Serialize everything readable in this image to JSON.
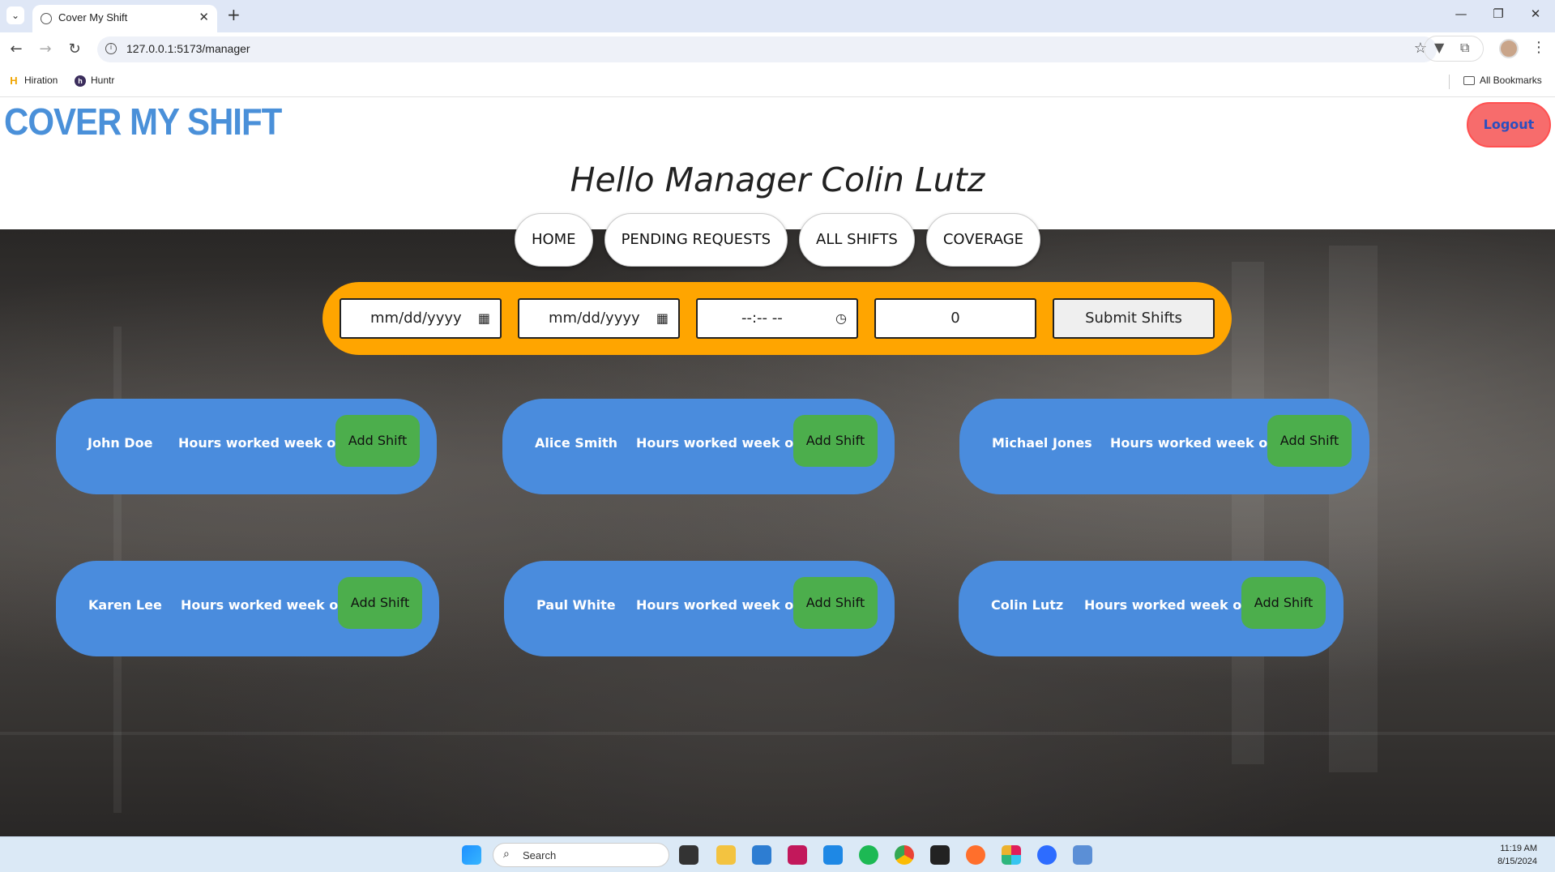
{
  "browser": {
    "tab_title": "Cover My Shift",
    "url": "127.0.0.1:5173/manager",
    "bookmarks": [
      {
        "label": "Hiration",
        "icon": "hiration-icon"
      },
      {
        "label": "Huntr",
        "icon": "huntr-icon"
      }
    ],
    "all_bookmarks": "All Bookmarks"
  },
  "header": {
    "logo": "COVER MY SHIFT",
    "logout": "Logout",
    "greeting": "Hello Manager Colin Lutz"
  },
  "nav": [
    "HOME",
    "PENDING REQUESTS",
    "ALL SHIFTS",
    "COVERAGE"
  ],
  "form": {
    "start_date_placeholder": "mm/dd/yyyy",
    "end_date_placeholder": "mm/dd/yyyy",
    "time_placeholder": "--:-- --",
    "hours_value": "0",
    "submit_label": "Submit Shifts"
  },
  "employees": [
    {
      "name": "John Doe",
      "hours_label": "Hours worked week of:",
      "add_label": "Add Shift"
    },
    {
      "name": "Alice Smith",
      "hours_label": "Hours worked week of:",
      "add_label": "Add Shift"
    },
    {
      "name": "Michael Jones",
      "hours_label": "Hours worked week of:",
      "add_label": "Add Shift"
    },
    {
      "name": "Karen Lee",
      "hours_label": "Hours worked week of:",
      "add_label": "Add Shift"
    },
    {
      "name": "Paul White",
      "hours_label": "Hours worked week of:",
      "add_label": "Add Shift"
    },
    {
      "name": "Colin Lutz",
      "hours_label": "Hours worked week of:",
      "add_label": "Add Shift"
    }
  ],
  "taskbar": {
    "search_label": "Search",
    "time": "11:19 AM",
    "date": "8/15/2024"
  },
  "colors": {
    "logo": "#4a90d9",
    "card": "#4a8cdd",
    "add_button": "#4cae4c",
    "form_bar": "#ffa500",
    "logout": "#f76c6c"
  }
}
